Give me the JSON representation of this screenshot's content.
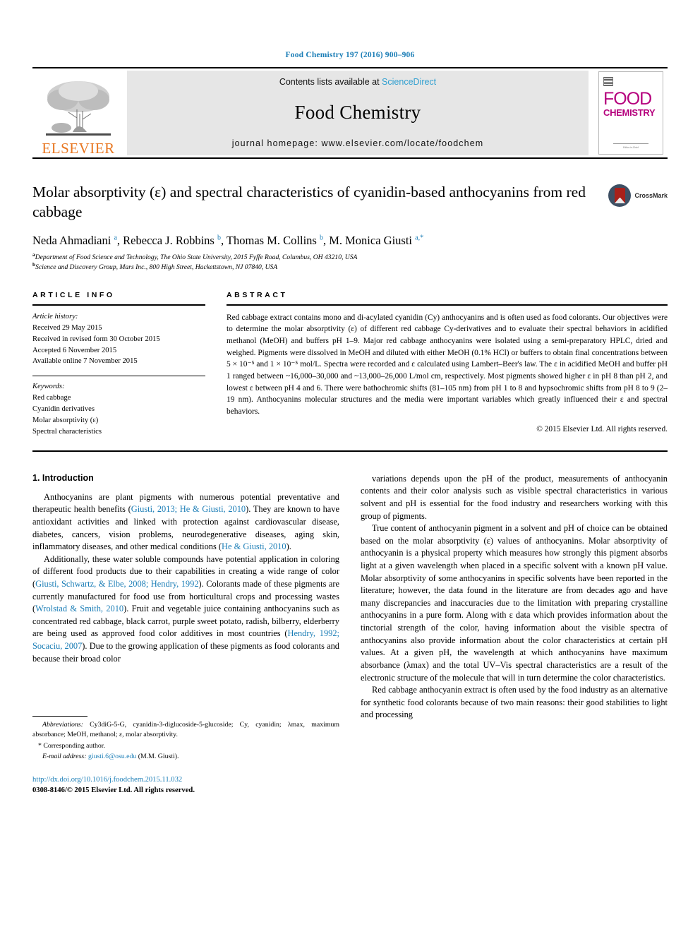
{
  "running_head": "Food Chemistry 197 (2016) 900–906",
  "masthead": {
    "publisher_name": "ELSEVIER",
    "contents_prefix": "Contents lists available at",
    "contents_link": "ScienceDirect",
    "journal_title": "Food Chemistry",
    "homepage_label": "journal homepage: www.elsevier.com/locate/foodchem",
    "cover": {
      "line1": "FOOD",
      "line2": "CHEMISTRY",
      "footer_text": "Editor-in-Chief"
    }
  },
  "article": {
    "title": "Molar absorptivity (ε) and spectral characteristics of cyanidin-based anthocyanins from red cabbage",
    "crossmark_label": "CrossMark",
    "authors_html": "Neda Ahmadiani <sup>a</sup>, Rebecca J. Robbins <sup>b</sup>, Thomas M. Collins <sup>b</sup>, M. Monica Giusti <sup>a,</sup><sup>*</sup>",
    "affiliations": [
      {
        "marker": "a",
        "text": "Department of Food Science and Technology, The Ohio State University, 2015 Fyffe Road, Columbus, OH 43210, USA"
      },
      {
        "marker": "b",
        "text": "Science and Discovery Group, Mars Inc., 800 High Street, Hackettstown, NJ 07840, USA"
      }
    ]
  },
  "article_info": {
    "heading": "ARTICLE INFO",
    "history_label": "Article history:",
    "history": [
      "Received 29 May 2015",
      "Received in revised form 30 October 2015",
      "Accepted 6 November 2015",
      "Available online 7 November 2015"
    ],
    "keywords_label": "Keywords:",
    "keywords": [
      "Red cabbage",
      "Cyanidin derivatives",
      "Molar absorptivity (ε)",
      "Spectral characteristics"
    ]
  },
  "abstract": {
    "heading": "ABSTRACT",
    "text": "Red cabbage extract contains mono and di-acylated cyanidin (Cy) anthocyanins and is often used as food colorants. Our objectives were to determine the molar absorptivity (ε) of different red cabbage Cy-derivatives and to evaluate their spectral behaviors in acidified methanol (MeOH) and buffers pH 1–9. Major red cabbage anthocyanins were isolated using a semi-preparatory HPLC, dried and weighed. Pigments were dissolved in MeOH and diluted with either MeOH (0.1% HCl) or buffers to obtain final concentrations between 5 × 10⁻⁵ and 1 × 10⁻⁵ mol/L. Spectra were recorded and ε calculated using Lambert–Beer's law. The ε in acidified MeOH and buffer pH 1 ranged between ~16,000–30,000 and ~13,000–26,000 L/mol cm, respectively. Most pigments showed higher ε in pH 8 than pH 2, and lowest ε between pH 4 and 6. There were bathochromic shifts (81–105 nm) from pH 1 to 8 and hypsochromic shifts from pH 8 to 9 (2–19 nm). Anthocyanins molecular structures and the media were important variables which greatly influenced their ε and spectral behaviors.",
    "copyright": "© 2015 Elsevier Ltd. All rights reserved."
  },
  "intro": {
    "heading": "1. Introduction",
    "left_paragraphs": [
      {
        "segments": [
          {
            "t": "Anthocyanins are plant pigments with numerous potential preventative and therapeutic health benefits ("
          },
          {
            "t": "Giusti, 2013; He & Giusti, 2010",
            "cite": true
          },
          {
            "t": "). They are known to have antioxidant activities and linked with protection against cardiovascular disease, diabetes, cancers, vision problems, neurodegenerative diseases, aging skin, inflammatory diseases, and other medical conditions ("
          },
          {
            "t": "He & Giusti, 2010",
            "cite": true
          },
          {
            "t": ")."
          }
        ]
      },
      {
        "segments": [
          {
            "t": "Additionally, these water soluble compounds have potential application in coloring of different food products due to their capabilities in creating a wide range of color ("
          },
          {
            "t": "Giusti, Schwartz, & Elbe, 2008; Hendry, 1992",
            "cite": true
          },
          {
            "t": "). Colorants made of these pigments are currently manufactured for food use from horticultural crops and processing wastes ("
          },
          {
            "t": "Wrolstad & Smith, 2010",
            "cite": true
          },
          {
            "t": "). Fruit and vegetable juice containing anthocyanins such as concentrated red cabbage, black carrot, purple sweet potato, radish, bilberry, elderberry are being used as approved food color additives in most countries ("
          },
          {
            "t": "Hendry, 1992; Socaciu, 2007",
            "cite": true
          },
          {
            "t": "). Due to the growing application of these pigments as food colorants and because their broad color"
          }
        ]
      }
    ],
    "right_paragraphs": [
      {
        "segments": [
          {
            "t": "variations depends upon the pH of the product, measurements of anthocyanin contents and their color analysis such as visible spectral characteristics in various solvent and pH is essential for the food industry and researchers working with this group of pigments.",
            "noindent": true
          }
        ]
      },
      {
        "segments": [
          {
            "t": "True content of anthocyanin pigment in a solvent and pH of choice can be obtained based on the molar absorptivity (ε) values of anthocyanins. Molar absorptivity of anthocyanin is a physical property which measures how strongly this pigment absorbs light at a given wavelength when placed in a specific solvent with a known pH value. Molar absorptivity of some anthocyanins in specific solvents have been reported in the literature; however, the data found in the literature are from decades ago and have many discrepancies and inaccuracies due to the limitation with preparing crystalline anthocyanins in a pure form. Along with ε data which provides information about the tinctorial strength of the color, having information about the visible spectra of anthocyanins also provide information about the color characteristics at certain pH values. At a given pH, the wavelength at which anthocyanins have maximum absorbance (λmax) and the total UV–Vis spectral characteristics are a result of the electronic structure of the molecule that will in turn determine the color characteristics."
          }
        ]
      },
      {
        "segments": [
          {
            "t": "Red cabbage anthocyanin extract is often used by the food industry as an alternative for synthetic food colorants because of two main reasons: their good stabilities to light and processing"
          }
        ]
      }
    ]
  },
  "footnotes": {
    "abbrev_label": "Abbreviations:",
    "abbrev_text": " Cy3diG-5-G, cyanidin-3-diglucoside-5-glucoside; Cy, cyanidin; λmax, maximum absorbance; MeOH, methanol; ε, molar absorptivity.",
    "corresponding": "Corresponding author.",
    "email_label": "E-mail address:",
    "email": "giusti.6@osu.edu",
    "email_suffix": " (M.M. Giusti).",
    "doi": "http://dx.doi.org/10.1016/j.foodchem.2015.11.032",
    "issn_line": "0308-8146/© 2015 Elsevier Ltd. All rights reserved."
  },
  "colors": {
    "link": "#1a7db6",
    "elsevier_orange": "#e87722",
    "cover_magenta": "#b5007d",
    "band_gray": "#e6e6e6"
  }
}
